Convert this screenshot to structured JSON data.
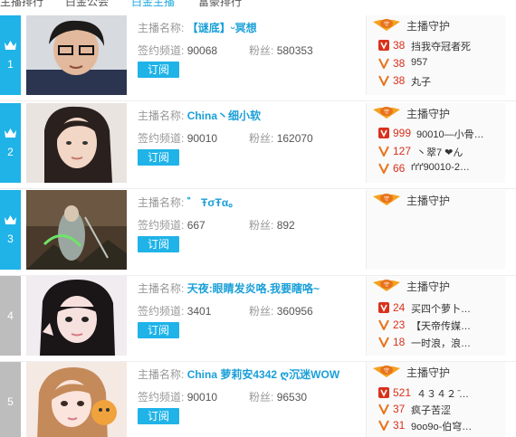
{
  "tabs": [
    {
      "label": "主播排行",
      "active": false
    },
    {
      "label": "白金公会",
      "active": false
    },
    {
      "label": "白金主播",
      "active": true
    },
    {
      "label": "富豪排行",
      "active": false
    }
  ],
  "labels": {
    "anchor_name": "主播名称:",
    "channel": "签约频道:",
    "fans": "粉丝:",
    "subscribe": "订阅",
    "guard_title": "主播守护"
  },
  "colors": {
    "accent": "#1fb3e8",
    "name": "#1a9fd8",
    "level_red": "#d9301c",
    "level_orange": "#e8731c",
    "rank_gray": "#bdbdbd"
  },
  "rows": [
    {
      "rank": "1",
      "name": "【谜底】ᵕ冥想",
      "channel": "90068",
      "fans": "580353",
      "guards": [
        {
          "level": "38",
          "user": "挡我夺冠者死",
          "icon": "v-red-icon"
        },
        {
          "level": "38",
          "user": "957",
          "icon": "v-orange-icon"
        },
        {
          "level": "38",
          "user": "丸子",
          "icon": "v-orange-icon"
        }
      ]
    },
    {
      "rank": "2",
      "name": "China丶细小软",
      "channel": "90010",
      "fans": "162070",
      "guards": [
        {
          "level": "999",
          "user": "90010—小骨…",
          "icon": "v-red-icon"
        },
        {
          "level": "127",
          "user": "丶翠7 ❤ん",
          "icon": "v-orange-icon"
        },
        {
          "level": "66",
          "user": "ґґґ90010-2…",
          "icon": "v-orange-icon"
        }
      ]
    },
    {
      "rank": "3",
      "name": "゛ ŦσŦα。",
      "channel": "667",
      "fans": "892",
      "guards": []
    },
    {
      "rank": "4",
      "name": "天夜:眼睛发炎咯.我要瞎咯~",
      "channel": "3401",
      "fans": "360956",
      "guards": [
        {
          "level": "24",
          "user": "买四个萝卜…",
          "icon": "v-red-icon"
        },
        {
          "level": "23",
          "user": "【天帝传媒…",
          "icon": "v-orange-icon"
        },
        {
          "level": "18",
          "user": "一时浪，浪…",
          "icon": "v-orange-icon"
        }
      ]
    },
    {
      "rank": "5",
      "name": "China 萝莉安4342 ღ沉迷WOW",
      "channel": "90010",
      "fans": "96530",
      "guards": [
        {
          "level": "521",
          "user": "４３４２ ̄…",
          "icon": "v-red-icon"
        },
        {
          "level": "37",
          "user": "疯子苦涩",
          "icon": "v-orange-icon"
        },
        {
          "level": "31",
          "user": "9oo9o-伯穹…",
          "icon": "v-orange-icon"
        }
      ]
    }
  ]
}
